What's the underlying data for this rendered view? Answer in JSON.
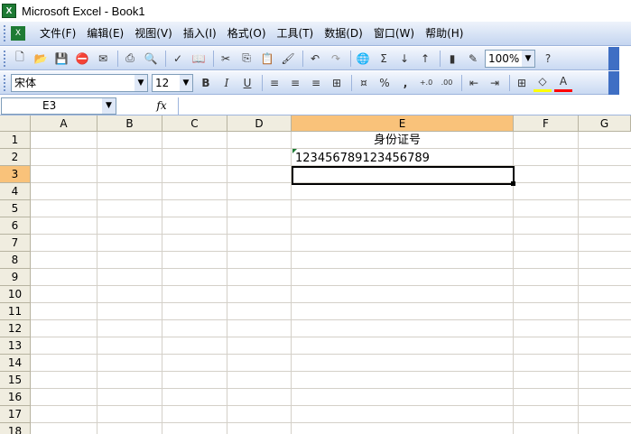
{
  "window": {
    "title": "Microsoft Excel - Book1"
  },
  "menu": [
    "文件(F)",
    "编辑(E)",
    "视图(V)",
    "插入(I)",
    "格式(O)",
    "工具(T)",
    "数据(D)",
    "窗口(W)",
    "帮助(H)"
  ],
  "toolbar": {
    "zoom": "100%",
    "font_name": "宋体",
    "font_size": "12",
    "bold": "B",
    "italic": "I",
    "underline": "U",
    "percent": "%",
    "comma": ",",
    "sigma": "Σ"
  },
  "formula_bar": {
    "name_box": "E3",
    "fx": "fx",
    "formula": ""
  },
  "columns": [
    "A",
    "B",
    "C",
    "D",
    "E",
    "F",
    "G"
  ],
  "rows": [
    "1",
    "2",
    "3",
    "4",
    "5",
    "6",
    "7",
    "8",
    "9",
    "10",
    "11",
    "12",
    "13",
    "14",
    "15",
    "16",
    "17",
    "18"
  ],
  "cells": {
    "E1": "身份证号",
    "E2": "123456789123456789"
  }
}
